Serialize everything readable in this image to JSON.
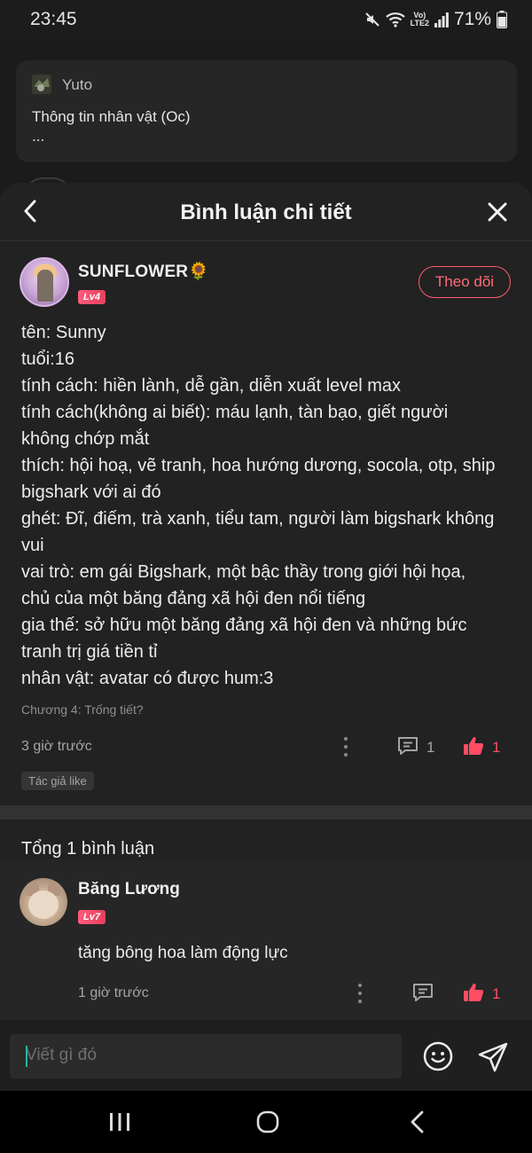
{
  "status_bar": {
    "time": "23:45",
    "network_label_top": "Vo)",
    "network_label_bottom": "LTE2",
    "battery": "71%",
    "icons": [
      "mute-icon",
      "wifi-icon",
      "signal-icon",
      "battery-icon"
    ]
  },
  "background_post": {
    "author": "Yuto",
    "title": "Thông tin nhân vật (Oc)",
    "more": "..."
  },
  "sheet": {
    "title": "Bình luận chi tiết",
    "back_icon": "chevron-left-icon",
    "close_icon": "close-icon"
  },
  "post": {
    "author": "SUNFLOWER🌻",
    "level": "Lv4",
    "follow_label": "Theo dõi",
    "lines": [
      "tên: Sunny",
      "tuổi:16",
      "tính cách: hiền lành, dễ gần, diễn xuất level max",
      "tính cách(không ai biết): máu lạnh, tàn bạo, giết người",
      "không chớp mắt",
      "thích: hội hoạ, vẽ tranh, hoa hướng dương, socola, otp, ship",
      "bigshark với ai đó",
      "ghét: Đĩ, điếm, trà xanh, tiểu tam, người làm bigshark không",
      "vui",
      "vai trò: em gái Bigshark, một bậc thầy trong giới hội họa,",
      "chủ của một băng đảng xã hội đen nổi tiếng",
      "gia thế: sở hữu một băng đảng xã hội đen và những bức",
      "tranh trị giá tiền tỉ",
      "nhân vật: avatar có được hum:3"
    ],
    "chapter": "Chương 4: Trống tiết?",
    "time": "3 giờ trước",
    "comment_count": "1",
    "like_count": "1",
    "author_like_tag": "Tác giả like"
  },
  "comments_section": {
    "total_label": "Tổng 1 bình luận",
    "items": [
      {
        "author": "Băng Lương",
        "level": "Lv7",
        "text": "tăng bông hoa làm động lực",
        "time": "1 giờ trước",
        "like_count": "1"
      }
    ]
  },
  "composer": {
    "placeholder": "Viết gì đó",
    "emoji_icon": "smiley-icon",
    "send_icon": "send-icon"
  },
  "colors": {
    "accent": "#ff4d64",
    "follow_border": "#ff5c6f",
    "sheet_bg": "#222222",
    "caret": "#2bb3a4"
  }
}
